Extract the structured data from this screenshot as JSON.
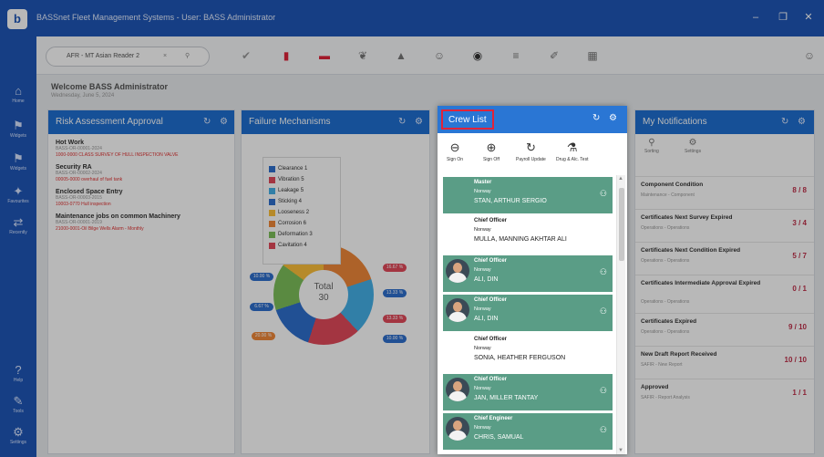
{
  "app": {
    "title": "BASSnet Fleet Management Systems - User: BASS Administrator",
    "logo": "b"
  },
  "window": {
    "minimize": "–",
    "maximize": "❐",
    "close": "✕"
  },
  "sidebar": {
    "items": [
      {
        "icon": "⌂",
        "label": "Home"
      },
      {
        "icon": "⚑",
        "label": "Widgets"
      },
      {
        "icon": "⚑",
        "label": "Widgets"
      },
      {
        "icon": "✦",
        "label": "Favourites"
      },
      {
        "icon": "⇄",
        "label": "Recently"
      },
      {
        "icon": "?",
        "label": "Help"
      },
      {
        "icon": "✎",
        "label": "Tools"
      },
      {
        "icon": "⚙",
        "label": "Settings"
      }
    ]
  },
  "toolbar": {
    "vessel": "AFR - MT Asian Reader 2",
    "clear": "×",
    "pin": "⚲",
    "icons": [
      "✔",
      "▮",
      "▬",
      "❦",
      "▲",
      "☺",
      "◉",
      "≡",
      "✐",
      "▦",
      "☺"
    ]
  },
  "welcome": {
    "title": "Welcome BASS Administrator",
    "date": "Wednesday, June 5, 2024"
  },
  "panels": {
    "risk": {
      "title": "Risk Assessment Approval",
      "items": [
        {
          "title": "Hot Work",
          "sub": "BASS-OR-00001-2024",
          "ref": "1000-0000 CLASS SURVEY OF HULL INSPECTION VALVE"
        },
        {
          "title": "Security RA",
          "sub": "BASS-OR-00002-2024",
          "ref": "00005-0000 overhaul of fuel tank"
        },
        {
          "title": "Enclosed Space Entry",
          "sub": "BASS-OR-00003-2015",
          "ref": "10003-0770 Hull inspection"
        },
        {
          "title": "Maintenance jobs on common Machinery",
          "sub": "BASS-OR-00001-2019",
          "ref": "21000-0001-Oil Bilge Wells Alarm - Monthly"
        }
      ]
    },
    "failure": {
      "title": "Failure Mechanisms",
      "legend": [
        "Clearance 1",
        "Vibration 5",
        "Leakage 5",
        "Sticking 4",
        "Looseness 2",
        "Corrosion 6",
        "Deformation 3",
        "Cavitation 4"
      ],
      "legend_colors": [
        "#2e6fce",
        "#e24a5a",
        "#45b0e8",
        "#2e6fce",
        "#fdbf3b",
        "#f0883a",
        "#7dbf5a",
        "#e24a5a"
      ],
      "total_label": "Total",
      "total": "30",
      "pills": [
        "10.00 %",
        "16.67 %",
        "13.33 %",
        "6.67 %",
        "13.33 %",
        "20.00 %",
        "10.00 %"
      ]
    },
    "notifications": {
      "title": "My Notifications",
      "tools": [
        {
          "icon": "⚲",
          "label": "Sorting"
        },
        {
          "icon": "⚙",
          "label": "Settings"
        }
      ],
      "items": [
        {
          "title": "Component Condition",
          "sub": "Maintenance - Component",
          "count": "8 / 8"
        },
        {
          "title": "Certificates Next Survey Expired",
          "sub": "Operations - Operations",
          "count": "3 / 4"
        },
        {
          "title": "Certificates Next Condition Expired",
          "sub": "Operations - Operations",
          "count": "5 / 7"
        },
        {
          "title": "Certificates Intermediate Approval Expired",
          "sub": "Operations - Operations",
          "count": "0 / 1"
        },
        {
          "title": "Certificates Expired",
          "sub": "Operations - Operations",
          "count": "9 / 10"
        },
        {
          "title": "New Draft Report Received",
          "sub": "SAFIR - New Report",
          "count": "10 / 10"
        },
        {
          "title": "Approved",
          "sub": "SAFIR - Report Analysis",
          "count": "1 / 1"
        }
      ]
    }
  },
  "crew": {
    "title": "Crew List",
    "actions": [
      {
        "icon": "⊖",
        "label": "Sign On"
      },
      {
        "icon": "⊕",
        "label": "Sign Off"
      },
      {
        "icon": "↻",
        "label": "Payroll Update"
      },
      {
        "icon": "⚗",
        "label": "Drug & Alc. Test"
      }
    ],
    "members": [
      {
        "rank": "Master",
        "nationality": "Norway",
        "name": "STAN, ARTHUR SERGIO"
      },
      {
        "rank": "Chief Officer",
        "nationality": "Norway",
        "name": "MULLA, MANNING AKHTAR ALI"
      },
      {
        "rank": "Chief Officer",
        "nationality": "Norway",
        "name": "ALI, DIN"
      },
      {
        "rank": "Chief Officer",
        "nationality": "Norway",
        "name": "ALI, DIN"
      },
      {
        "rank": "Chief Officer",
        "nationality": "Norway",
        "name": "SONIA, HEATHER FERGUSON"
      },
      {
        "rank": "Chief Officer",
        "nationality": "Norway",
        "name": "JAN, MILLER TANTAY"
      },
      {
        "rank": "Chief Engineer",
        "nationality": "Norway",
        "name": "CHRIS, SAMUAL"
      }
    ]
  }
}
